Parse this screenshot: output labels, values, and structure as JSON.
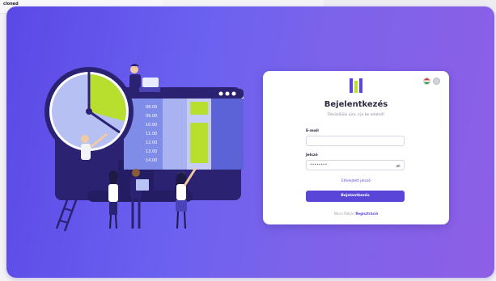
{
  "background": {
    "tab_label": "cloned"
  },
  "login": {
    "title": "Bejelentkezés",
    "subtitle": "Üdvözöljük újra, írja be adatait!",
    "email_label": "E-mail",
    "email_value": "",
    "password_label": "Jelszó",
    "password_value": "••••••••",
    "forgot_label": "Elfelejtett jelszó",
    "login_button": "Bejelentkezés",
    "no_account_text": "Nincs fiókja?",
    "register_link": "Regisztráció"
  },
  "languages": [
    "HU",
    "EN"
  ],
  "illustration": {
    "schedule_times": [
      "08.00",
      "09.00",
      "10.00",
      "11.00",
      "12.00",
      "13.00",
      "14.00"
    ]
  },
  "colors": {
    "gradient_start": "#5b49e6",
    "gradient_end": "#8d5fe6",
    "accent": "#5a45d9",
    "lime": "#b9df2e"
  }
}
